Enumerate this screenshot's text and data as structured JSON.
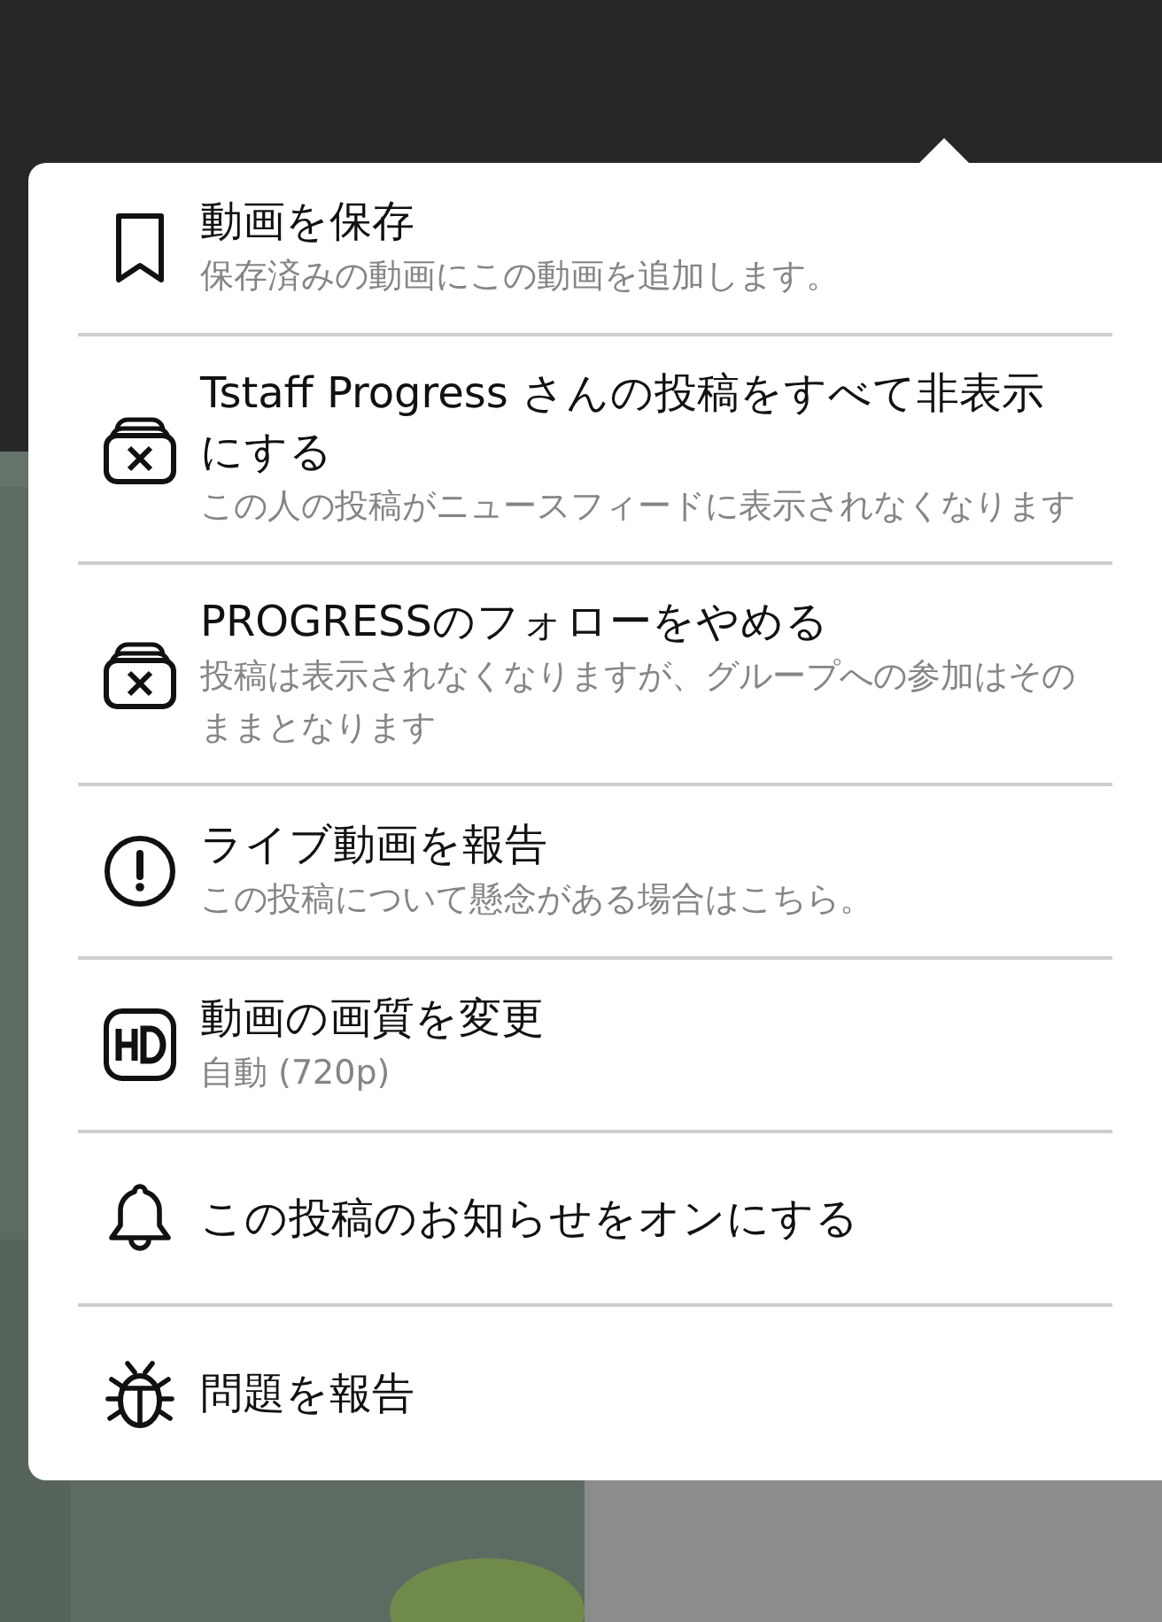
{
  "menu": {
    "items": [
      {
        "title": "動画を保存",
        "subtitle": "保存済みの動画にこの動画を追加します。"
      },
      {
        "title": "Tstaff Progress さんの投稿をすべて非表示にする",
        "subtitle": "この人の投稿がニュースフィードに表示されなくなります"
      },
      {
        "title": "PROGRESSのフォローをやめる",
        "subtitle": "投稿は表示されなくなりますが、グループへの参加はそのままとなります"
      },
      {
        "title": "ライブ動画を報告",
        "subtitle": "この投稿について懸念がある場合はこちら。"
      },
      {
        "title": "動画の画質を変更",
        "subtitle": "自動 (720p)"
      },
      {
        "title": "この投稿のお知らせをオンにする"
      },
      {
        "title": "問題を報告"
      }
    ]
  }
}
